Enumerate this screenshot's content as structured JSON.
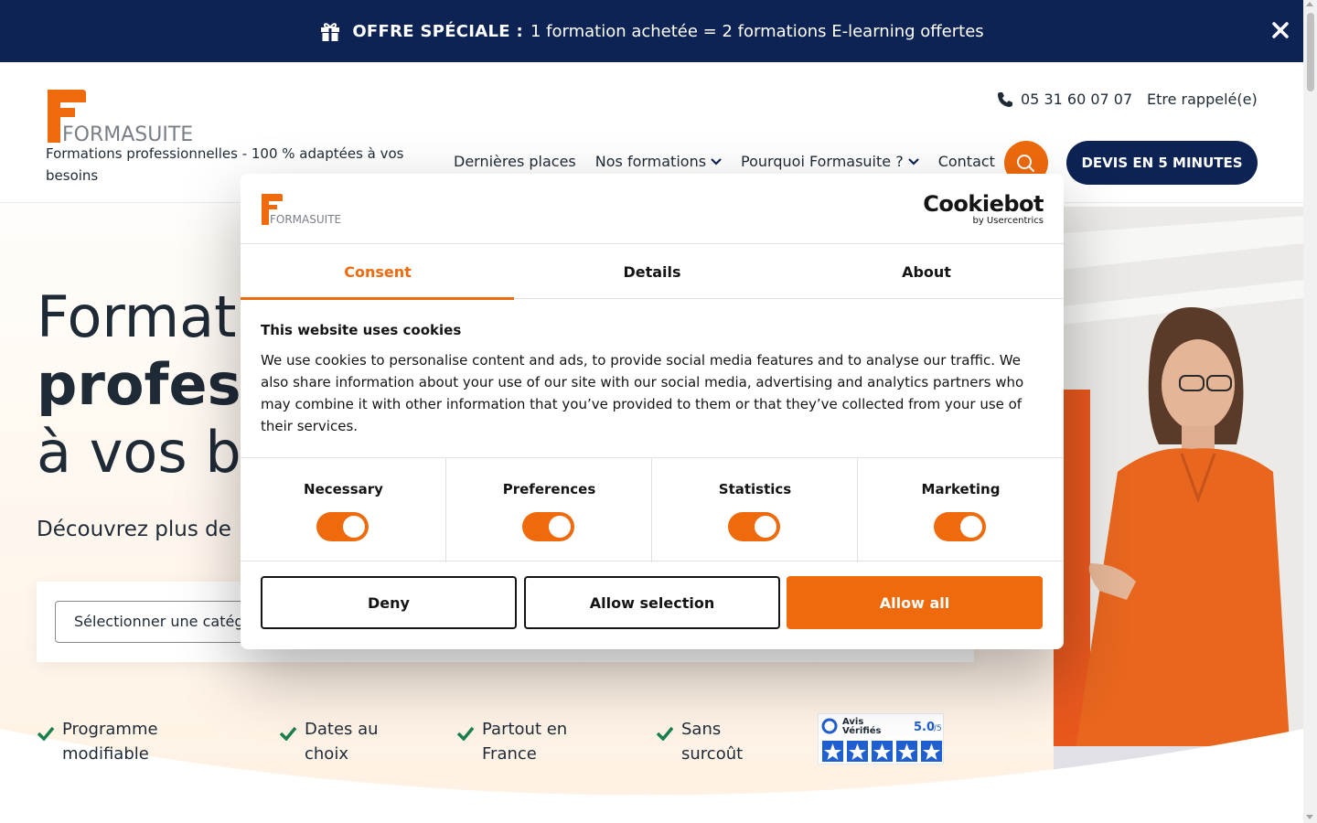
{
  "promo": {
    "bold": "OFFRE SPÉCIALE :",
    "text": "1 formation achetée = 2 formations E-learning offertes"
  },
  "header": {
    "logo_text": "FORMASUITE",
    "tagline": "Formations professionnelles - 100 % adaptées à vos besoins",
    "phone": "05 31 60 07 07",
    "callback": "Etre rappelé(e)",
    "nav": [
      "Dernières places",
      "Nos formations",
      "Pourquoi Formasuite ?",
      "Contact"
    ],
    "cta": "DEVIS EN 5 MINUTES"
  },
  "hero": {
    "line1": "Formatic",
    "line2": "profess",
    "line3": "à vos be",
    "subtitle": "Découvrez plus de",
    "select_placeholder": "Sélectionner une catég",
    "features": [
      {
        "line1": "Programme",
        "line2": "modifiable"
      },
      {
        "line1": "Dates au",
        "line2": "choix"
      },
      {
        "line1": "Partout en",
        "line2": "France"
      },
      {
        "line1": "Sans",
        "line2": "surcoût"
      }
    ],
    "avis": {
      "name1": "Avis",
      "name2": "Vérifiés",
      "score": "5.0",
      "scale": "/5"
    }
  },
  "cookie": {
    "logo_text": "FORMASUITE",
    "brand": "Cookiebot",
    "brand_by": "by Usercentrics",
    "tabs": [
      "Consent",
      "Details",
      "About"
    ],
    "title": "This website uses cookies",
    "body": "We use cookies to personalise content and ads, to provide social media features and to analyse our traffic. We also share information about your use of our site with our social media, advertising and analytics partners who may combine it with other information that you’ve provided to them or that they’ve collected from your use of their services.",
    "toggles": [
      {
        "label": "Necessary",
        "on": true
      },
      {
        "label": "Preferences",
        "on": true
      },
      {
        "label": "Statistics",
        "on": true
      },
      {
        "label": "Marketing",
        "on": true
      }
    ],
    "buttons": {
      "deny": "Deny",
      "selection": "Allow selection",
      "all": "Allow all"
    }
  },
  "colors": {
    "navy": "#0d2354",
    "orange": "#ee6a0c",
    "text": "#1f2a37",
    "green": "#1b7f4b"
  }
}
